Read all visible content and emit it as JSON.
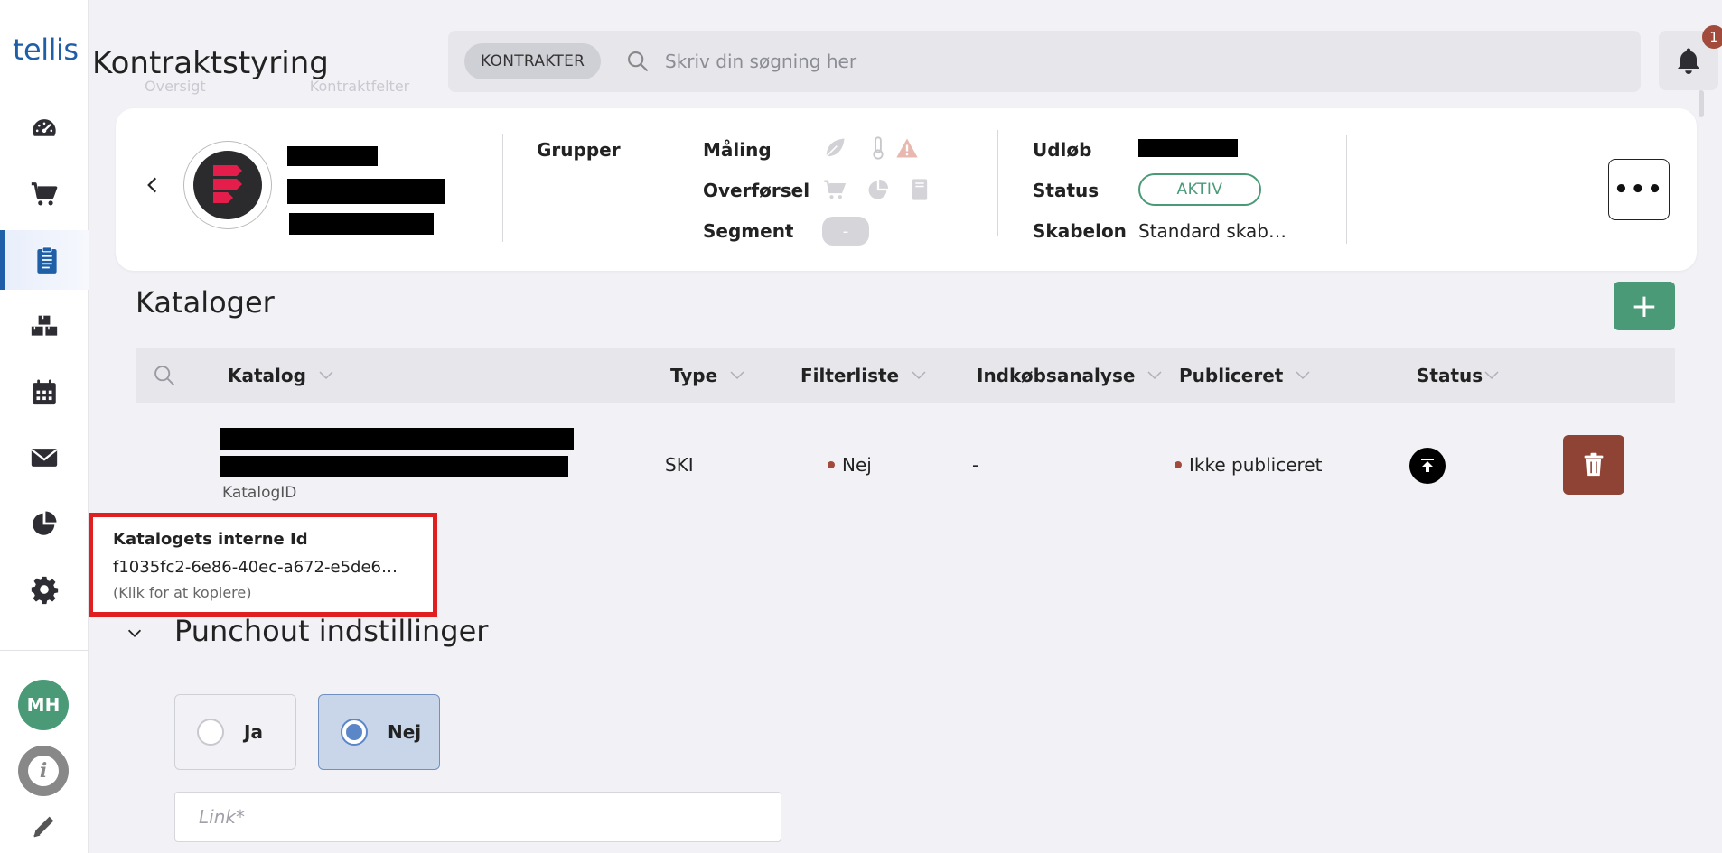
{
  "app": {
    "logo": "tellis",
    "title": "Kontraktstyring"
  },
  "ghost_tabs": [
    "Oversigt",
    "Kontraktfelter"
  ],
  "search": {
    "chip": "KONTRAKTER",
    "placeholder": "Skriv din søgning her"
  },
  "notifications": {
    "count": "1"
  },
  "sidebar": {
    "items": [
      {
        "name": "dashboard",
        "icon": "speedometer-icon"
      },
      {
        "name": "cart",
        "icon": "cart-icon"
      },
      {
        "name": "contracts",
        "icon": "clipboard-icon",
        "active": true
      },
      {
        "name": "products",
        "icon": "boxes-icon"
      },
      {
        "name": "calendar",
        "icon": "calendar-icon"
      },
      {
        "name": "mail",
        "icon": "mail-icon"
      },
      {
        "name": "reports",
        "icon": "pie-chart-icon"
      },
      {
        "name": "settings",
        "icon": "gear-icon"
      }
    ],
    "user_initials": "MH"
  },
  "contract_card": {
    "groups_label": "Grupper",
    "maaling_label": "Måling",
    "overfoersel_label": "Overførsel",
    "segment_label": "Segment",
    "segment_value": "-",
    "udloeb_label": "Udløb",
    "status_label": "Status",
    "status_value": "AKTIV",
    "skabelon_label": "Skabelon",
    "skabelon_value": "Standard skab…",
    "more_label": "•••"
  },
  "catalogs": {
    "title": "Kataloger",
    "add_label": "+",
    "columns": {
      "katalog": "Katalog",
      "type": "Type",
      "filterliste": "Filterliste",
      "indkobsanalyse": "Indkøbsanalyse",
      "publiceret": "Publiceret",
      "status": "Status"
    },
    "rows": [
      {
        "id_label": "KatalogID",
        "type": "SKI",
        "filterliste": "Nej",
        "indkobsanalyse": "-",
        "publiceret": "Ikke publiceret"
      }
    ]
  },
  "tooltip": {
    "title": "Katalogets interne Id",
    "value": "f1035fc2-6e86-40ec-a672-e5de6…",
    "hint": "(Klik for at kopiere)"
  },
  "punchout": {
    "title": "Punchout indstillinger",
    "option_yes": "Ja",
    "option_no": "Nej",
    "selected": "Nej",
    "link_placeholder": "Link*"
  },
  "colors": {
    "brand": "#1f5fa8",
    "green": "#4a9a78",
    "danger": "#8e4335",
    "highlight": "#e02020"
  }
}
